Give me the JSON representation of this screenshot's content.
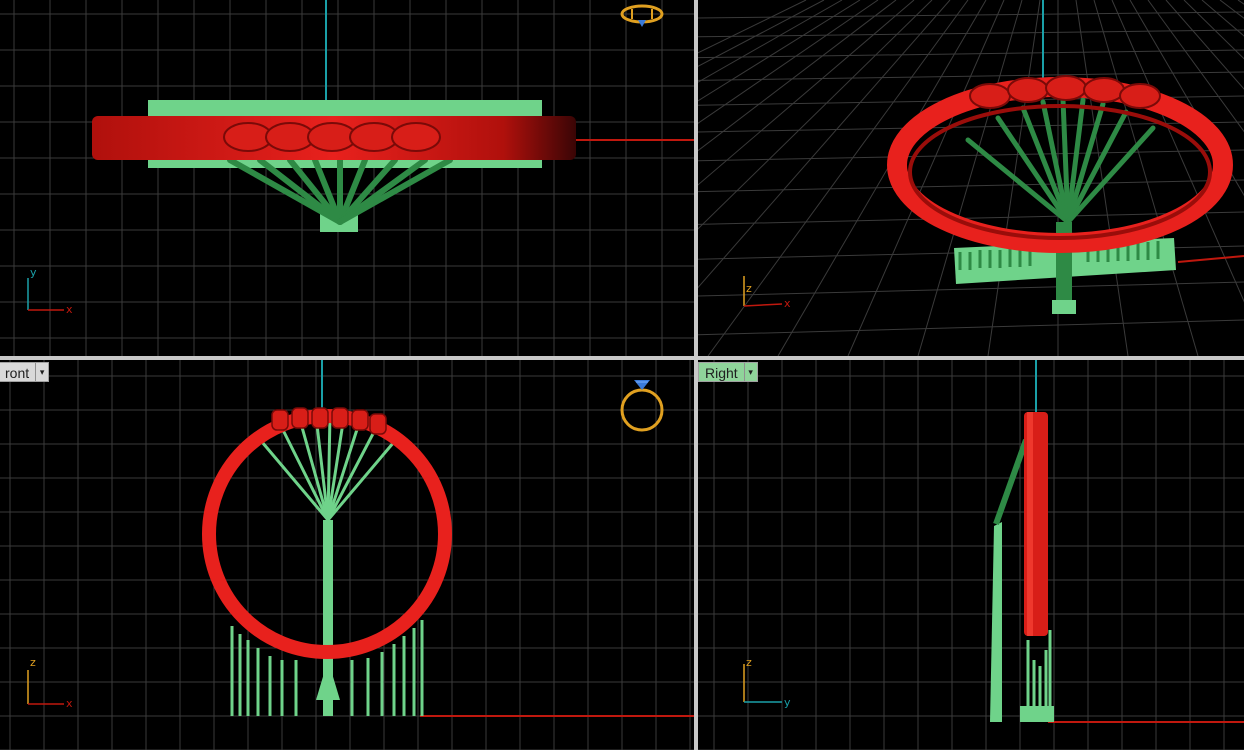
{
  "viewports": [
    {
      "id": "top",
      "label": "",
      "axes": {
        "vertical": "y",
        "horizontal": "x"
      }
    },
    {
      "id": "perspective",
      "label": "",
      "axes": {
        "vertical": "z",
        "horizontal": "x"
      }
    },
    {
      "id": "front",
      "label": "ront",
      "axes": {
        "vertical": "z",
        "horizontal": "x"
      }
    },
    {
      "id": "right",
      "label": "Right",
      "axes": {
        "vertical": "z",
        "horizontal": "y"
      }
    }
  ],
  "colors": {
    "background": "#000000",
    "ring": "#e8211d",
    "supports": "#2e8a45",
    "base_plate": "#6fd38a",
    "x_axis": "#c0180e",
    "y_axis": "#1aa0a8",
    "gizmo": "#e0a020"
  },
  "icons": {
    "view_cube": "ring-gizmo-icon",
    "label_menu": "chevron-down-icon"
  },
  "caret_glyph": "▾"
}
